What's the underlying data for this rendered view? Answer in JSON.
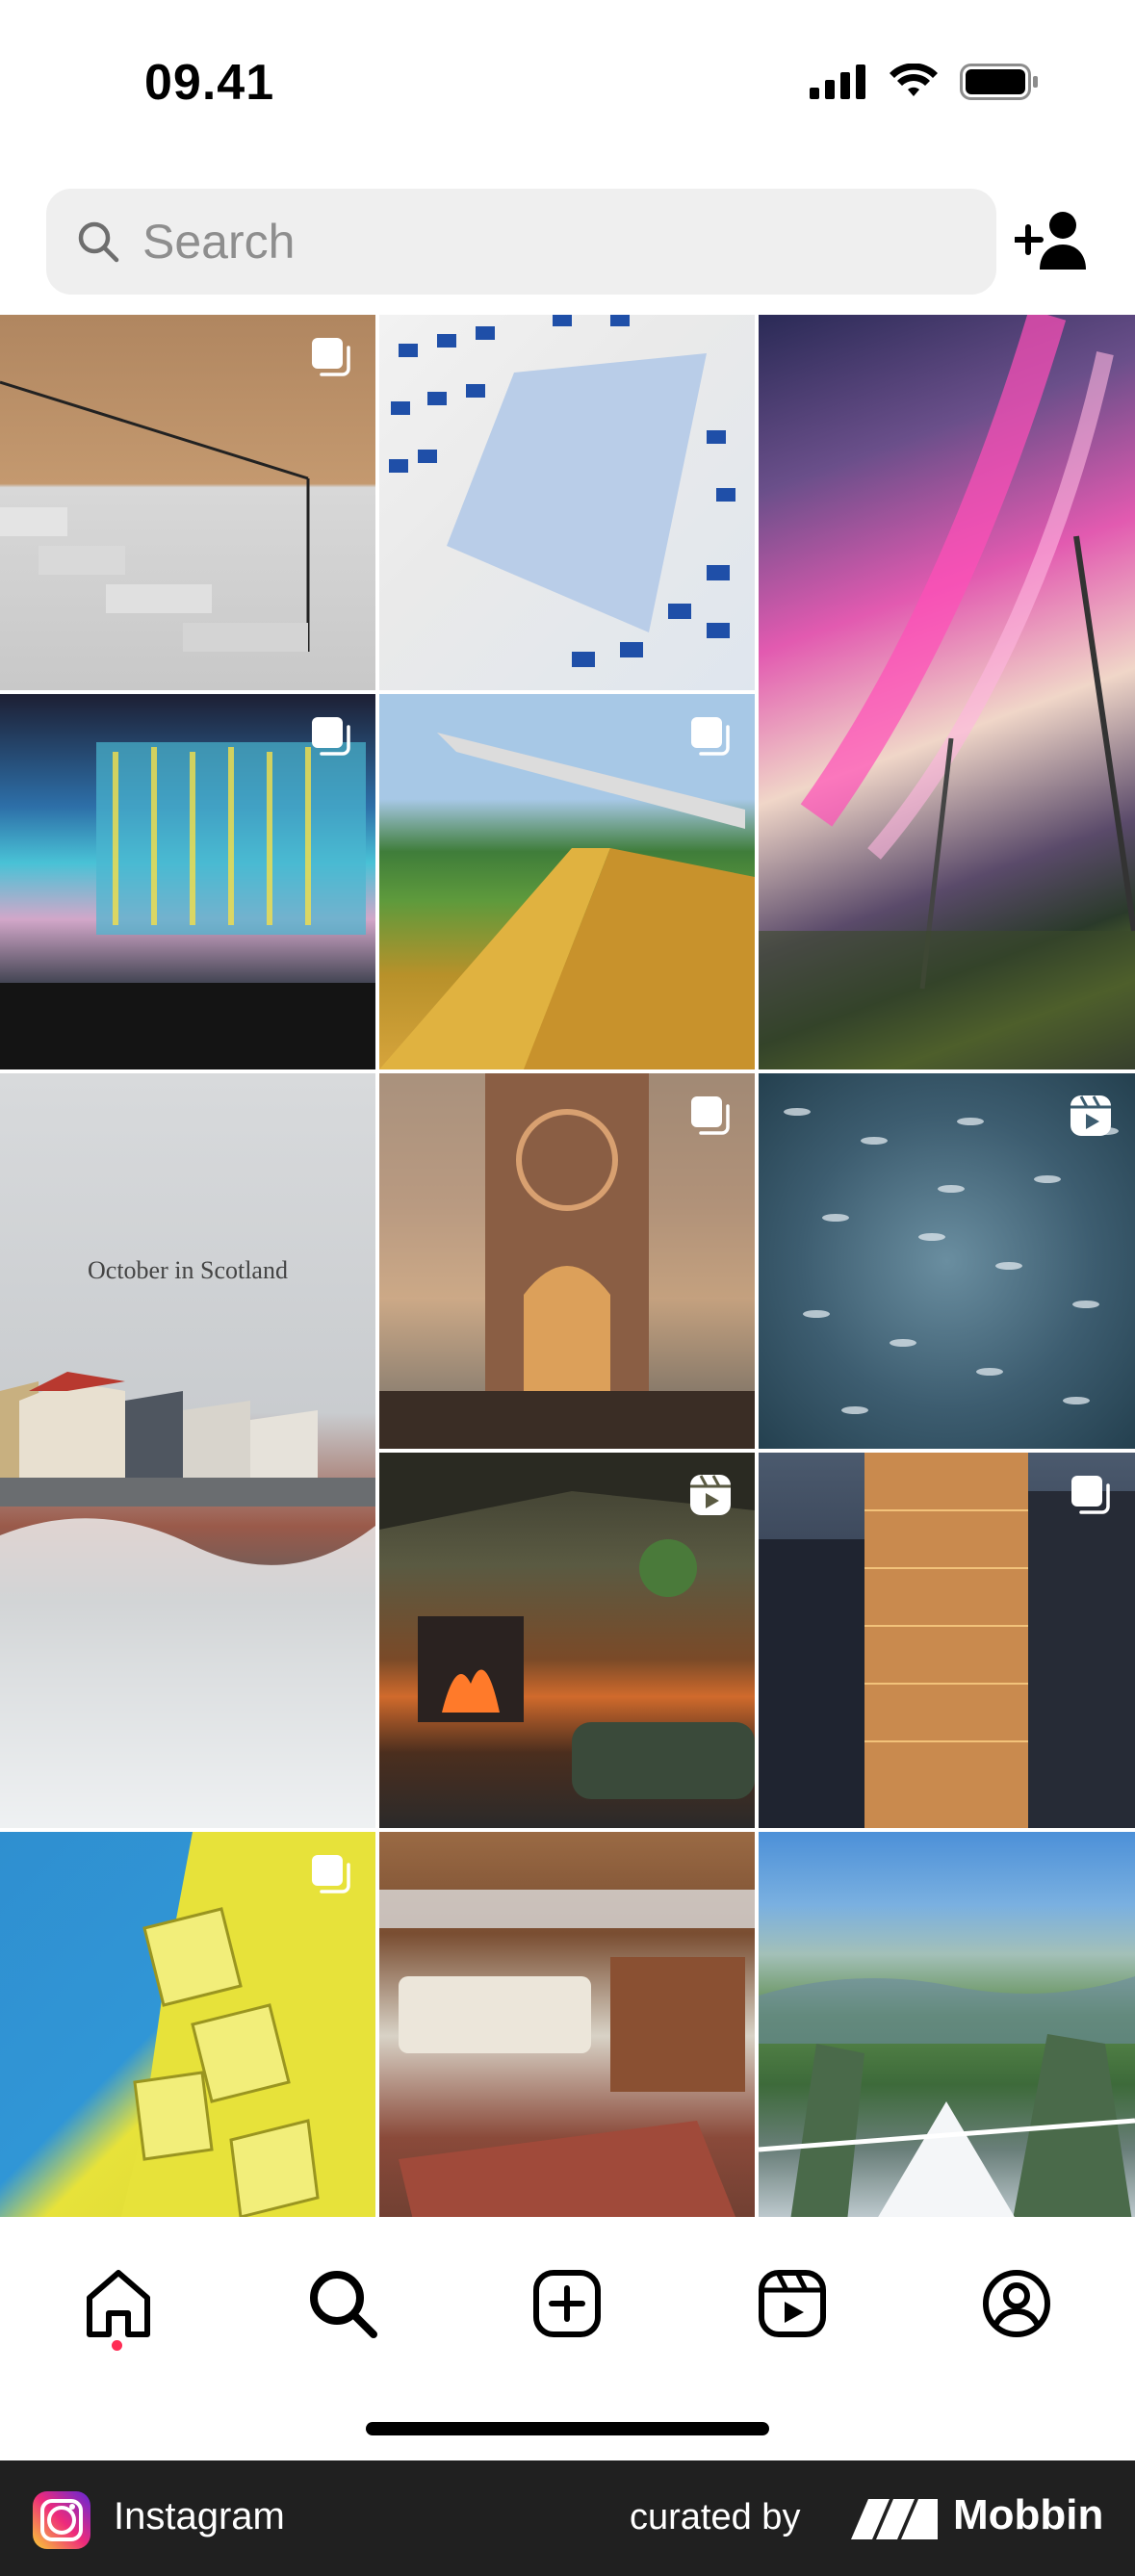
{
  "status_bar": {
    "time": "09.41"
  },
  "search": {
    "placeholder": "Search"
  },
  "grid": {
    "tiles": [
      {
        "id": "stairs",
        "badge": "carousel-icon"
      },
      {
        "id": "windows",
        "badge": ""
      },
      {
        "id": "aurora",
        "badge": ""
      },
      {
        "id": "lights",
        "badge": "carousel-icon"
      },
      {
        "id": "bridge",
        "badge": "carousel-icon"
      },
      {
        "id": "scotland",
        "badge": "",
        "caption": "October in Scotland"
      },
      {
        "id": "cathedral",
        "badge": "carousel-icon"
      },
      {
        "id": "fish",
        "badge": "reels-icon"
      },
      {
        "id": "cabin",
        "badge": "reels-icon"
      },
      {
        "id": "tower",
        "badge": "carousel-icon"
      },
      {
        "id": "yellow",
        "badge": "carousel-icon"
      },
      {
        "id": "room",
        "badge": ""
      },
      {
        "id": "mountains",
        "badge": ""
      }
    ]
  },
  "tab_bar": {
    "tabs": [
      "home-icon",
      "search-icon",
      "create-icon",
      "reels-icon",
      "profile-icon"
    ],
    "active": "home-icon",
    "indicator_color": "#ff2d55"
  },
  "footer": {
    "app_name": "Instagram",
    "curated_label": "curated by",
    "brand": "Mobbin"
  }
}
